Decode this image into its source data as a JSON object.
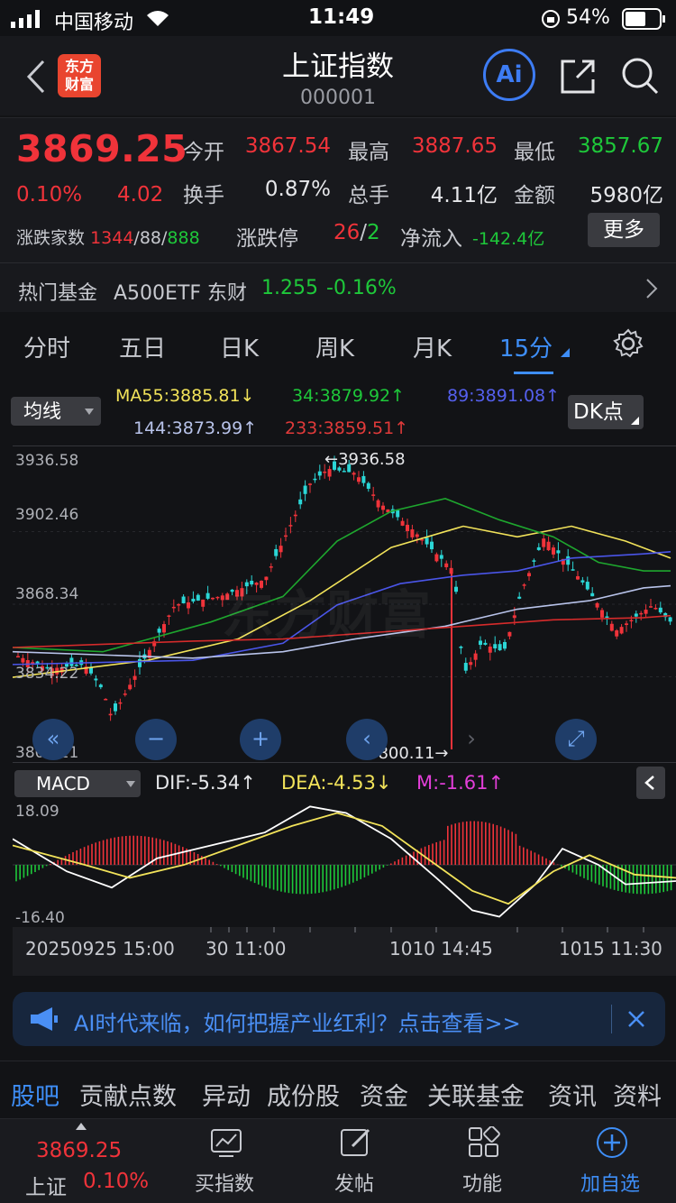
{
  "status_bar": {
    "carrier": "中国移动",
    "time": "11:49",
    "battery": "54%"
  },
  "header": {
    "title": "上证指数",
    "code": "000001",
    "logo_line1": "东方",
    "logo_line2": "财富",
    "ai_label": "Ai"
  },
  "quote": {
    "price": "3869.25",
    "change_pct": "0.10%",
    "change_abs": "4.02",
    "open_label": "今开",
    "open": "3867.54",
    "high_label": "最高",
    "high": "3887.65",
    "low_label": "最低",
    "low": "3857.67",
    "turnover_label": "换手",
    "turnover": "0.87%",
    "volume_label": "总手",
    "volume": "4.11亿",
    "amount_label": "金额",
    "amount": "5980亿",
    "breadth_label": "涨跌家数",
    "breadth_up": "1344",
    "breadth_flat": "88",
    "breadth_down": "888",
    "breadth_sep": "/",
    "limit_label": "涨跌停",
    "limit_up": "26",
    "limit_down": "2",
    "netflow_label": "净流入",
    "netflow": "-142.4亿",
    "more_label": "更多"
  },
  "fund": {
    "label": "热门基金",
    "name": "A500ETF 东财",
    "price": "1.255",
    "change": "-0.16%"
  },
  "period_tabs": [
    "分时",
    "五日",
    "日K",
    "周K",
    "月K",
    "15分"
  ],
  "active_period": "15分",
  "ma": {
    "dropdown": "均线",
    "ma55": "MA55:3885.81↓",
    "ma34": "34:3879.92↑",
    "ma89": "89:3891.08↑",
    "ma144": "144:3873.99↑",
    "ma233": "233:3859.51↑",
    "dk_label": "DK点"
  },
  "chart_axis": {
    "y_ticks": [
      "3936.58",
      "3902.46",
      "3868.34",
      "3834.22",
      "3800.11"
    ],
    "max_marker": "←3936.58",
    "min_marker": "3800.11→",
    "watermark": "东方财富"
  },
  "macd": {
    "dropdown": "MACD",
    "dif": "DIF:-5.34↑",
    "dea": "DEA:-4.53↓",
    "m": "M:-1.61↑",
    "y_top": "18.09",
    "y_bottom": "-16.40"
  },
  "dates": {
    "d1": "20250925 15:00",
    "d2": "30 11:00",
    "d3": "1010 14:45",
    "d4": "1015 11:30"
  },
  "banner": {
    "text": "AI时代来临，如何把握产业红利？点击查看>>"
  },
  "sub_tabs": [
    "股吧",
    "贡献点数",
    "异动",
    "成份股",
    "资金",
    "关联基金",
    "资讯",
    "资料"
  ],
  "bottom_bar": {
    "index_price": "3869.25",
    "index_name": "上证",
    "index_pct": "0.10%",
    "buy_label": "买指数",
    "post_label": "发帖",
    "func_label": "功能",
    "add_label": "加自选"
  },
  "colors": {
    "up": "#f0333a",
    "down": "#1ec83a",
    "accent": "#3e8ef7"
  },
  "chart_data": {
    "type": "candlestick",
    "y_range": [
      3800.11,
      3936.58
    ],
    "ma_lines": [
      {
        "name": "MA55",
        "value": 3885.81,
        "color": "#f2e35a"
      },
      {
        "name": "34",
        "value": 3879.92,
        "color": "#1ea62e"
      },
      {
        "name": "89",
        "value": 3891.08,
        "color": "#4a55e8"
      },
      {
        "name": "144",
        "value": 3873.99,
        "color": "#b8c3ea"
      },
      {
        "name": "233",
        "value": 3859.51,
        "color": "#d62b2b"
      }
    ],
    "macd": {
      "dif": -5.34,
      "dea": -4.53,
      "m": -1.61,
      "y_range": [
        -16.4,
        18.09
      ]
    }
  }
}
